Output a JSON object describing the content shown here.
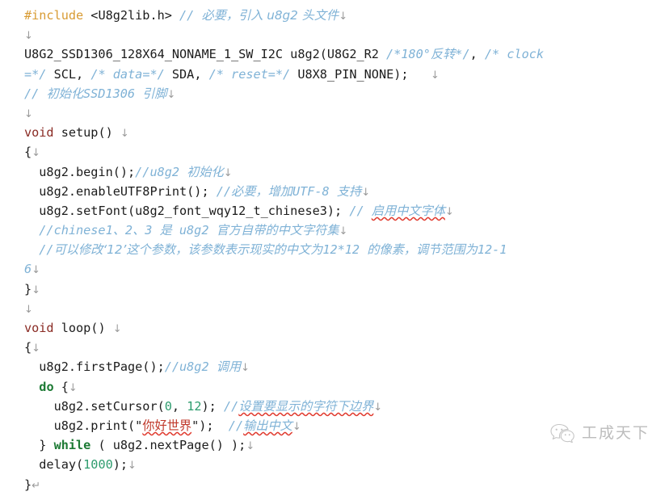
{
  "document": {
    "kind": "code-listing",
    "language": "Arduino C++",
    "colors": {
      "background": "#ffffff",
      "plain": "#1c1c1c",
      "preprocessor": "#d89b33",
      "keyword": "#8a2b24",
      "keyword_bold": "#1d7a34",
      "number": "#2e9c6e",
      "string": "#c0392b",
      "comment": "#7fb2d6",
      "formatting_mark": "#9a9a9a",
      "spellcheck_underline": "#e03b2f",
      "watermark": "#8d8d8d"
    },
    "marks": {
      "soft_return": "↓",
      "hard_return": "↵"
    }
  },
  "lines": [
    {
      "id": "line-01",
      "tokens": [
        {
          "t": "preproc",
          "v": "#include"
        },
        {
          "t": "plain",
          "v": " <U8g2lib.h> "
        },
        {
          "t": "comment",
          "v": "// "
        },
        {
          "t": "comment-cjk",
          "v": "必要，引入 u8g2 头文件"
        },
        {
          "t": "mark-soft",
          "v": "↓"
        }
      ]
    },
    {
      "id": "line-02",
      "tokens": [
        {
          "t": "mark-soft",
          "v": "↓"
        }
      ]
    },
    {
      "id": "line-03",
      "tokens": [
        {
          "t": "plain",
          "v": "U8G2_SSD1306_128X64_NONAME_1_SW_I2C u8g2(U8G2_R2 "
        },
        {
          "t": "comment",
          "v": "/*180°"
        },
        {
          "t": "comment-cjk",
          "v": "反转"
        },
        {
          "t": "comment",
          "v": "*/"
        },
        {
          "t": "plain",
          "v": ", "
        },
        {
          "t": "comment",
          "v": "/* clock"
        }
      ]
    },
    {
      "id": "line-04",
      "tokens": [
        {
          "t": "comment",
          "v": "=*/"
        },
        {
          "t": "plain",
          "v": " SCL, "
        },
        {
          "t": "comment",
          "v": "/* data=*/"
        },
        {
          "t": "plain",
          "v": " SDA, "
        },
        {
          "t": "comment",
          "v": "/* reset=*/"
        },
        {
          "t": "plain",
          "v": " U8X8_PIN_NONE);   "
        },
        {
          "t": "mark-soft",
          "v": "↓"
        }
      ]
    },
    {
      "id": "line-05",
      "tokens": [
        {
          "t": "comment",
          "v": "// "
        },
        {
          "t": "comment-cjk",
          "v": "初始化"
        },
        {
          "t": "comment",
          "v": "SSD1306 "
        },
        {
          "t": "comment-cjk",
          "v": "引脚"
        },
        {
          "t": "mark-soft",
          "v": "↓"
        }
      ]
    },
    {
      "id": "line-06",
      "tokens": [
        {
          "t": "mark-soft",
          "v": "↓"
        }
      ]
    },
    {
      "id": "line-07",
      "tokens": [
        {
          "t": "keyword",
          "v": "void"
        },
        {
          "t": "plain",
          "v": " setup() "
        },
        {
          "t": "mark-soft",
          "v": "↓"
        }
      ]
    },
    {
      "id": "line-08",
      "tokens": [
        {
          "t": "plain",
          "v": "{"
        },
        {
          "t": "mark-soft",
          "v": "↓"
        }
      ]
    },
    {
      "id": "line-09",
      "tokens": [
        {
          "t": "plain",
          "v": "  u8g2.begin();"
        },
        {
          "t": "comment",
          "v": "//u8g2 "
        },
        {
          "t": "comment-cjk",
          "v": "初始化"
        },
        {
          "t": "mark-soft",
          "v": "↓"
        }
      ]
    },
    {
      "id": "line-10",
      "tokens": [
        {
          "t": "plain",
          "v": "  u8g2.enableUTF8Print(); "
        },
        {
          "t": "comment",
          "v": "//"
        },
        {
          "t": "comment-cjk",
          "v": "必要，增加"
        },
        {
          "t": "comment",
          "v": "UTF-8 "
        },
        {
          "t": "comment-cjk",
          "v": "支持"
        },
        {
          "t": "mark-soft",
          "v": "↓"
        }
      ]
    },
    {
      "id": "line-11",
      "tokens": [
        {
          "t": "plain",
          "v": "  u8g2.setFont(u8g2_font_wqy12_t_chinese3); "
        },
        {
          "t": "comment",
          "v": "// "
        },
        {
          "t": "comment-cjk-squiggle",
          "v": "启用中文字体"
        },
        {
          "t": "mark-soft",
          "v": "↓"
        }
      ]
    },
    {
      "id": "line-12",
      "tokens": [
        {
          "t": "comment",
          "v": "  //chinese1"
        },
        {
          "t": "comment-cjk",
          "v": "、"
        },
        {
          "t": "comment",
          "v": "2"
        },
        {
          "t": "comment-cjk",
          "v": "、"
        },
        {
          "t": "comment",
          "v": "3 "
        },
        {
          "t": "comment-cjk",
          "v": "是"
        },
        {
          "t": "comment",
          "v": " u8g2 "
        },
        {
          "t": "comment-cjk",
          "v": "官方自带的中文字符集"
        },
        {
          "t": "mark-soft",
          "v": "↓"
        }
      ]
    },
    {
      "id": "line-13",
      "tokens": [
        {
          "t": "comment",
          "v": "  //"
        },
        {
          "t": "comment-cjk",
          "v": "可以修改‘12’这个参数，该参数表示现实的中文为"
        },
        {
          "t": "comment",
          "v": "12*12 "
        },
        {
          "t": "comment-cjk",
          "v": "的像素，调节范围为"
        },
        {
          "t": "comment",
          "v": "12-1"
        }
      ]
    },
    {
      "id": "line-14",
      "tokens": [
        {
          "t": "comment",
          "v": "6"
        },
        {
          "t": "mark-soft",
          "v": "↓"
        }
      ]
    },
    {
      "id": "line-15",
      "tokens": [
        {
          "t": "plain",
          "v": "}"
        },
        {
          "t": "mark-soft",
          "v": "↓"
        }
      ]
    },
    {
      "id": "line-16",
      "tokens": [
        {
          "t": "mark-soft",
          "v": "↓"
        }
      ]
    },
    {
      "id": "line-17",
      "tokens": [
        {
          "t": "keyword",
          "v": "void"
        },
        {
          "t": "plain",
          "v": " loop() "
        },
        {
          "t": "mark-soft",
          "v": "↓"
        }
      ]
    },
    {
      "id": "line-18",
      "tokens": [
        {
          "t": "plain",
          "v": "{"
        },
        {
          "t": "mark-soft",
          "v": "↓"
        }
      ]
    },
    {
      "id": "line-19",
      "tokens": [
        {
          "t": "plain",
          "v": "  u8g2.firstPage();"
        },
        {
          "t": "comment",
          "v": "//u8g2 "
        },
        {
          "t": "comment-cjk",
          "v": "调用"
        },
        {
          "t": "mark-soft",
          "v": "↓"
        }
      ]
    },
    {
      "id": "line-20",
      "tokens": [
        {
          "t": "plain",
          "v": "  "
        },
        {
          "t": "keyword-bold",
          "v": "do"
        },
        {
          "t": "plain",
          "v": " {"
        },
        {
          "t": "mark-soft",
          "v": "↓"
        }
      ]
    },
    {
      "id": "line-21",
      "tokens": [
        {
          "t": "plain",
          "v": "    u8g2.setCursor("
        },
        {
          "t": "number",
          "v": "0"
        },
        {
          "t": "plain",
          "v": ", "
        },
        {
          "t": "number",
          "v": "12"
        },
        {
          "t": "plain",
          "v": "); "
        },
        {
          "t": "comment",
          "v": "//"
        },
        {
          "t": "comment-cjk-squiggle",
          "v": "设置要显示的字符下边界"
        },
        {
          "t": "mark-soft",
          "v": "↓"
        }
      ]
    },
    {
      "id": "line-22",
      "tokens": [
        {
          "t": "plain",
          "v": "    u8g2.print("
        },
        {
          "t": "plain",
          "v": "\""
        },
        {
          "t": "string-squiggle",
          "v": "你好世界"
        },
        {
          "t": "plain",
          "v": "\""
        },
        {
          "t": "plain",
          "v": ");  "
        },
        {
          "t": "comment",
          "v": "//"
        },
        {
          "t": "comment-cjk-squiggle",
          "v": "输出中文"
        },
        {
          "t": "mark-soft",
          "v": "↓"
        }
      ]
    },
    {
      "id": "line-23",
      "tokens": [
        {
          "t": "plain",
          "v": "  } "
        },
        {
          "t": "keyword-bold",
          "v": "while"
        },
        {
          "t": "plain",
          "v": " ( u8g2.nextPage() );"
        },
        {
          "t": "mark-soft",
          "v": "↓"
        }
      ]
    },
    {
      "id": "line-24",
      "tokens": [
        {
          "t": "plain",
          "v": "  delay("
        },
        {
          "t": "number",
          "v": "1000"
        },
        {
          "t": "plain",
          "v": ");"
        },
        {
          "t": "mark-soft",
          "v": "↓"
        }
      ]
    },
    {
      "id": "line-25",
      "tokens": [
        {
          "t": "plain",
          "v": "}"
        },
        {
          "t": "mark-hard",
          "v": "↵"
        }
      ]
    }
  ],
  "watermark": {
    "icon": "wechat-logo-icon",
    "text": "工成天下"
  }
}
